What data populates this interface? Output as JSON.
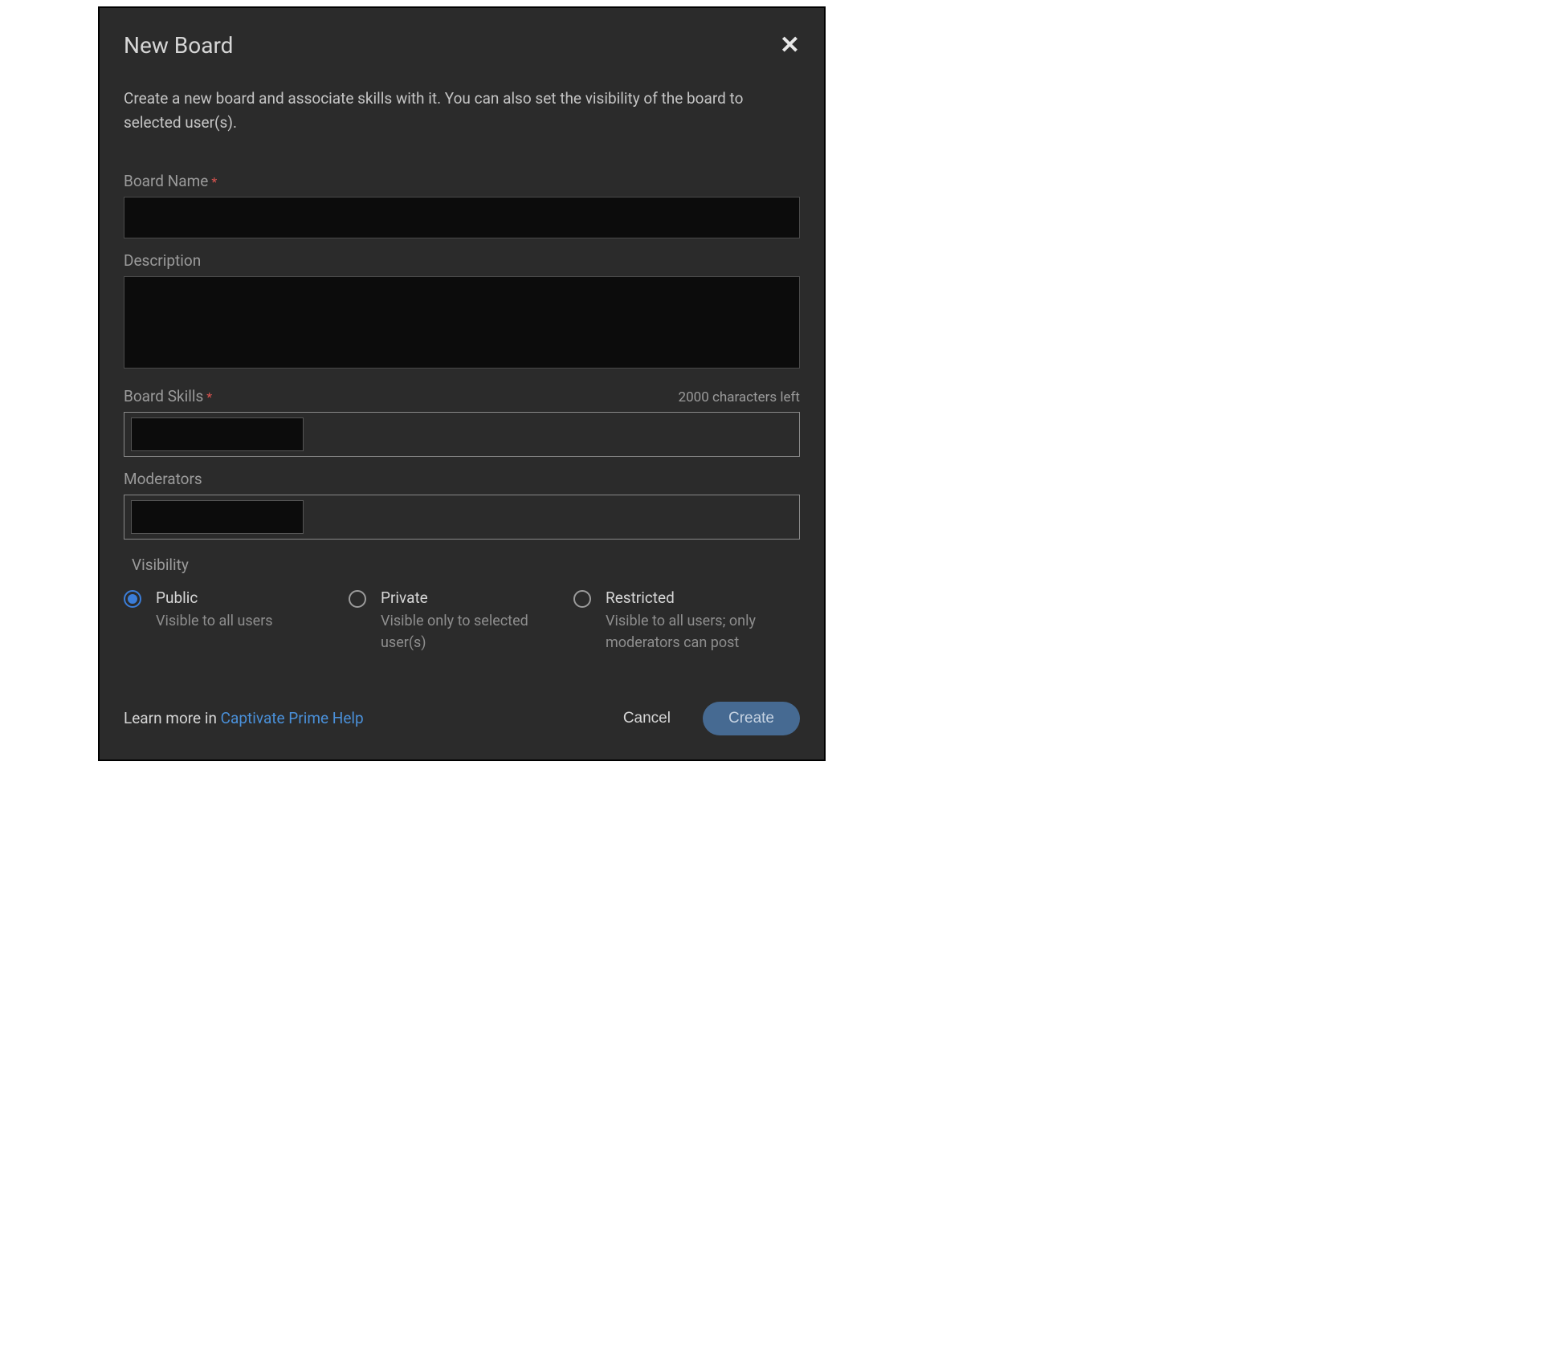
{
  "modal": {
    "title": "New Board",
    "subtitle": "Create a new board and associate skills with it. You can also set the visibility of the board to selected user(s).",
    "close_icon_glyph": "✕",
    "fields": {
      "board_name": {
        "label": "Board Name",
        "required": true,
        "value": ""
      },
      "description": {
        "label": "Description",
        "value": "",
        "char_counter": "2000 characters left"
      },
      "board_skills": {
        "label": "Board Skills",
        "required": true,
        "value": ""
      },
      "moderators": {
        "label": "Moderators",
        "value": ""
      }
    },
    "visibility": {
      "label": "Visibility",
      "selected": "public",
      "options": [
        {
          "id": "public",
          "title": "Public",
          "desc": "Visible to all users"
        },
        {
          "id": "private",
          "title": "Private",
          "desc": "Visible only to selected user(s)"
        },
        {
          "id": "restricted",
          "title": "Restricted",
          "desc": "Visible to all users; only moderators can post"
        }
      ]
    },
    "footer": {
      "help_prefix": "Learn more in ",
      "help_link": "Captivate Prime Help",
      "cancel": "Cancel",
      "create": "Create"
    }
  }
}
